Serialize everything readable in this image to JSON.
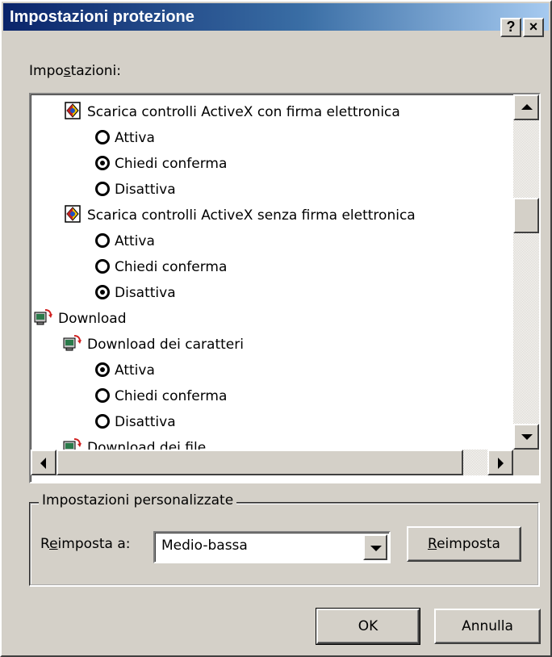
{
  "window": {
    "title": "Impostazioni protezione",
    "help_button": "?",
    "close_button": "×"
  },
  "settings_label": {
    "pre": "Impo",
    "accel": "s",
    "post": "tazioni:"
  },
  "tree": [
    {
      "type": "category",
      "icon": "activex-icon",
      "label": "Scarica controlli ActiveX con firma elettronica"
    },
    {
      "type": "option",
      "label": "Attiva",
      "checked": false
    },
    {
      "type": "option",
      "label": "Chiedi conferma",
      "checked": true
    },
    {
      "type": "option",
      "label": "Disattiva",
      "checked": false
    },
    {
      "type": "category",
      "icon": "activex-icon",
      "label": "Scarica controlli ActiveX senza firma elettronica"
    },
    {
      "type": "option",
      "label": "Attiva",
      "checked": false
    },
    {
      "type": "option",
      "label": "Chiedi conferma",
      "checked": false
    },
    {
      "type": "option",
      "label": "Disattiva",
      "checked": true
    },
    {
      "type": "group",
      "icon": "download-icon",
      "label": "Download"
    },
    {
      "type": "category",
      "icon": "download-icon",
      "label": "Download dei caratteri"
    },
    {
      "type": "option",
      "label": "Attiva",
      "checked": true
    },
    {
      "type": "option",
      "label": "Chiedi conferma",
      "checked": false
    },
    {
      "type": "option",
      "label": "Disattiva",
      "checked": false
    },
    {
      "type": "category",
      "icon": "download-icon",
      "label": "Download dei file"
    }
  ],
  "custom_settings": {
    "legend": "Impostazioni personalizzate",
    "reset_to_label": {
      "pre": "R",
      "accel": "e",
      "post": "imposta a:"
    },
    "reset_to_value": "Medio-bassa",
    "reset_button": {
      "accel": "R",
      "post": "eimposta"
    }
  },
  "buttons": {
    "ok": "OK",
    "cancel": "Annulla"
  },
  "colors": {
    "titlebar_start": "#0a246a",
    "titlebar_end": "#a6caf0",
    "face": "#d4d0c8"
  }
}
